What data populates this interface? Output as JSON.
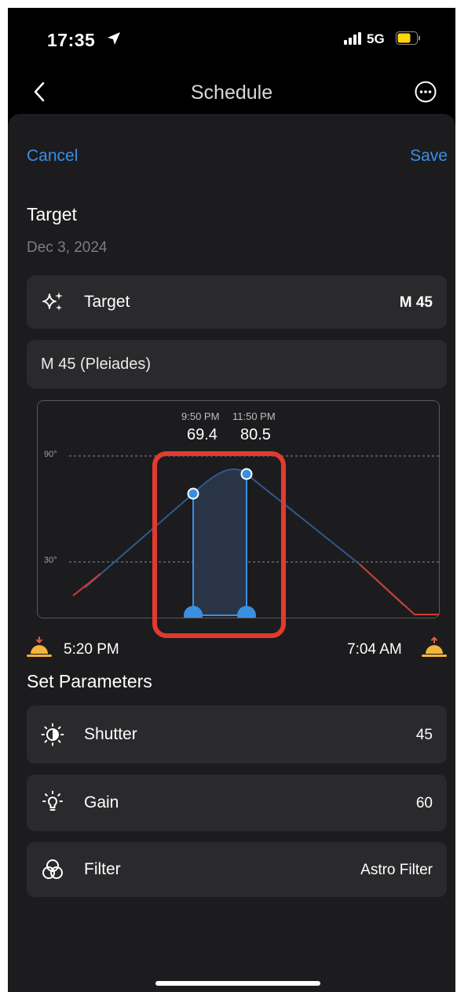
{
  "status_bar": {
    "time": "17:35",
    "network": "5G",
    "battery_color": "#ffd60a"
  },
  "nav": {
    "title": "Schedule"
  },
  "actions": {
    "cancel": "Cancel",
    "save": "Save"
  },
  "target_section": {
    "title": "Target",
    "date": "Dec 3, 2024",
    "target_row": {
      "icon": "sparkle-icon",
      "label": "Target",
      "value": "M 45"
    },
    "target_name": "M 45 (Pleiades)"
  },
  "chart": {
    "selection": [
      {
        "time": "9:50 PM",
        "altitude": "69.4"
      },
      {
        "time": "11:50 PM",
        "altitude": "80.5"
      }
    ],
    "grid_labels": [
      "90°",
      "30°"
    ],
    "sunset": {
      "icon": "sunset-icon",
      "time": "5:20 PM"
    },
    "sunrise": {
      "icon": "sunrise-icon",
      "time": "7:04 AM"
    },
    "colors": {
      "curve_day": "#d13b36",
      "curve_night": "#2e5a8f",
      "handle": "#3b8fe0",
      "fill": "#2a3447"
    }
  },
  "chart_data": {
    "type": "line",
    "title": "",
    "xlabel": "",
    "ylabel": "",
    "x": [
      "5:20 PM",
      "9:50 PM",
      "11:50 PM",
      "7:04 AM"
    ],
    "series": [
      {
        "values": [
          0,
          69.4,
          80.5,
          0
        ]
      }
    ],
    "ylim": [
      0,
      90
    ],
    "gridlines": [
      30,
      90
    ],
    "selected_range": [
      "9:50 PM",
      "11:50 PM"
    ]
  },
  "parameters": {
    "title": "Set Parameters",
    "items": [
      {
        "icon": "shutter-icon",
        "label": "Shutter",
        "value": "45"
      },
      {
        "icon": "gain-icon",
        "label": "Gain",
        "value": "60"
      },
      {
        "icon": "filter-icon",
        "label": "Filter",
        "value": "Astro Filter"
      }
    ]
  }
}
